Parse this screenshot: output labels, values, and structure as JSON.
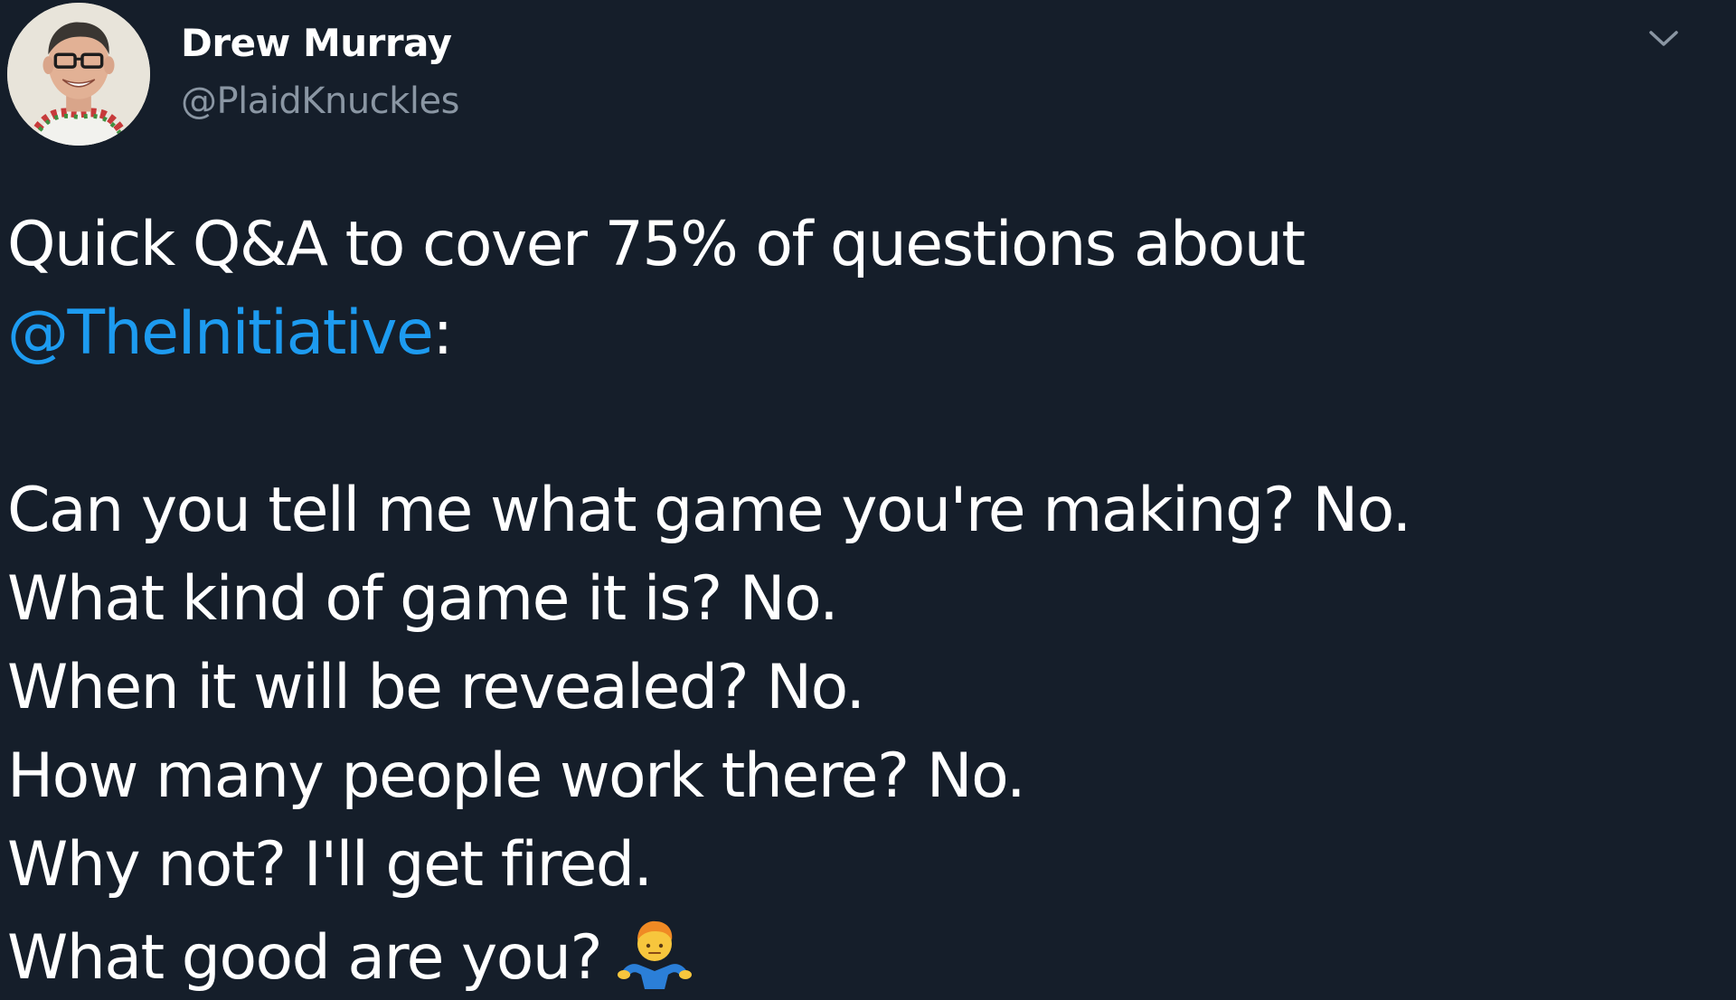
{
  "author": {
    "display_name": "Drew Murray",
    "handle": "@PlaidKnuckles",
    "avatar_icon": "profile-photo"
  },
  "menu": {
    "icon": "chevron-down-icon"
  },
  "tweet": {
    "intro": "Quick Q&A to cover 75% of questions about",
    "mention": "@TheInitiative",
    "mention_suffix": ":",
    "lines": [
      "Can you tell me what game you're making? No.",
      "What kind of game it is? No.",
      "When it will be revealed? No.",
      "How many people work there? No.",
      "Why not? I'll get fired.",
      "What good are you?"
    ],
    "emoji": "man-shrugging-emoji"
  },
  "colors": {
    "background": "#151e2a",
    "text": "#ffffff",
    "handle": "#8a96a3",
    "mention": "#1d9bf0"
  }
}
